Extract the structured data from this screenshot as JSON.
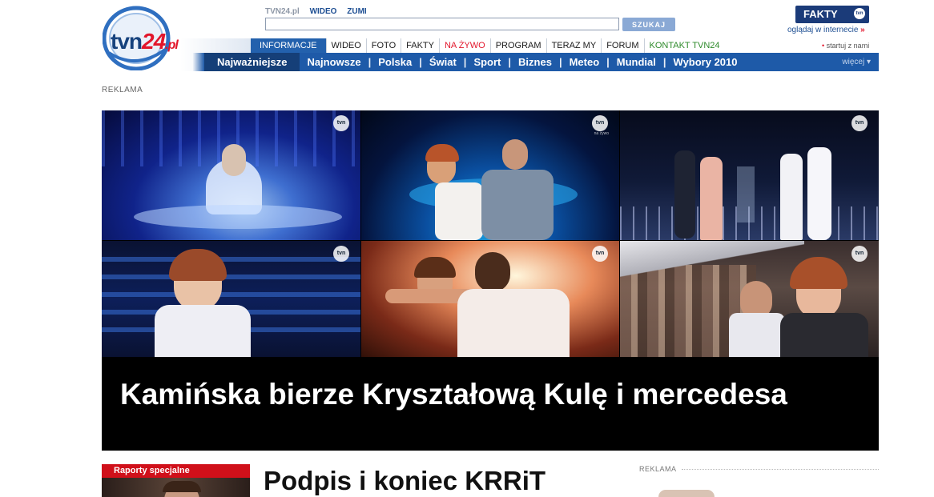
{
  "logo": {
    "text_main": "tvn",
    "text_accent": "24",
    "text_suffix": ".pl"
  },
  "top_links": {
    "site": "TVN24.pl",
    "video": "WIDEO",
    "zumi": "ZUMI"
  },
  "search": {
    "value": "",
    "placeholder": "",
    "button_label": "SZUKAJ"
  },
  "fakty": {
    "logo_text": "FAKTY",
    "badge": "tvn",
    "watch_label": "oglądaj w internecie",
    "watch_arrow": "»"
  },
  "primary_nav": {
    "items": [
      "INFORMACJE",
      "WIDEO",
      "FOTO",
      "FAKTY",
      "NA ŻYWO",
      "PROGRAM",
      "TERAZ MY",
      "FORUM",
      "KONTAKT TVN24"
    ],
    "homepage_bullet": "•",
    "homepage_label": "startuj z nami"
  },
  "section_nav": {
    "items": [
      "Najważniejsze",
      "Najnowsze",
      "Polska",
      "Świat",
      "Sport",
      "Biznes",
      "Meteo",
      "Mundial",
      "Wybory 2010"
    ],
    "separator": "|",
    "more_label": "więcej ▾"
  },
  "ad_label": "REKLAMA",
  "hero": {
    "headline": "Kamińska bierze Kryształową Kulę i mercedesa",
    "watermark": "tvn",
    "watermark_sub": "na żywo"
  },
  "reports": {
    "header": "Raporty specjalne"
  },
  "main_headline": "Podpis i koniec KRRiT",
  "side_ad_label": "REKLAMA",
  "colors": {
    "brand_blue": "#1e5aa8",
    "accent_red": "#e2162b",
    "nav_active": "#2361ad"
  }
}
